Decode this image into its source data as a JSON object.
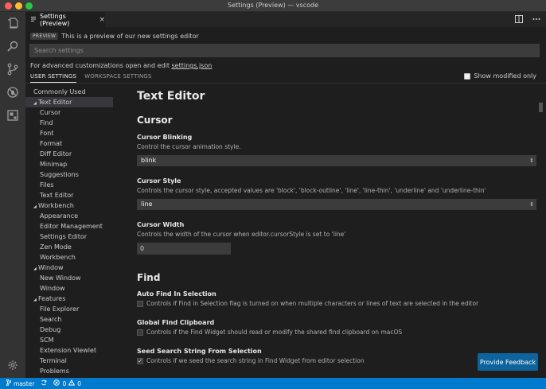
{
  "window": {
    "title": "Settings (Preview) — vscode"
  },
  "tab": {
    "label": "Settings (Preview)",
    "close": "×"
  },
  "preview": {
    "badge": "PREVIEW",
    "text": "This is a preview of our new settings editor"
  },
  "search": {
    "placeholder": "Search settings"
  },
  "advanced": {
    "prefix": "For advanced customizations open and edit ",
    "link": "settings.json"
  },
  "scopes": {
    "user": "USER SETTINGS",
    "workspace": "WORKSPACE SETTINGS",
    "show_modified": "Show modified only"
  },
  "toc": [
    {
      "label": "Commonly Used",
      "level": 0,
      "tri": ""
    },
    {
      "label": "Text Editor",
      "level": 1,
      "tri": "◢",
      "selected": true
    },
    {
      "label": "Cursor",
      "level": 2
    },
    {
      "label": "Find",
      "level": 2
    },
    {
      "label": "Font",
      "level": 2
    },
    {
      "label": "Format",
      "level": 2
    },
    {
      "label": "Diff Editor",
      "level": 2
    },
    {
      "label": "Minimap",
      "level": 2
    },
    {
      "label": "Suggestions",
      "level": 2
    },
    {
      "label": "Files",
      "level": 2
    },
    {
      "label": "Text Editor",
      "level": 2
    },
    {
      "label": "Workbench",
      "level": 1,
      "tri": "◢"
    },
    {
      "label": "Appearance",
      "level": 2
    },
    {
      "label": "Editor Management",
      "level": 2
    },
    {
      "label": "Settings Editor",
      "level": 2
    },
    {
      "label": "Zen Mode",
      "level": 2
    },
    {
      "label": "Workbench",
      "level": 2
    },
    {
      "label": "Window",
      "level": 1,
      "tri": "◢"
    },
    {
      "label": "New Window",
      "level": 2
    },
    {
      "label": "Window",
      "level": 2
    },
    {
      "label": "Features",
      "level": 1,
      "tri": "◢"
    },
    {
      "label": "File Explorer",
      "level": 2
    },
    {
      "label": "Search",
      "level": 2
    },
    {
      "label": "Debug",
      "level": 2
    },
    {
      "label": "SCM",
      "level": 2
    },
    {
      "label": "Extension Viewlet",
      "level": 2
    },
    {
      "label": "Terminal",
      "level": 2
    },
    {
      "label": "Problems",
      "level": 2
    }
  ],
  "content": {
    "group_title": "Text Editor",
    "cursor_section": "Cursor",
    "cursor_blinking": {
      "title": "Cursor Blinking",
      "desc": "Control the cursor animation style.",
      "value": "blink"
    },
    "cursor_style": {
      "title": "Cursor Style",
      "desc": "Controls the cursor style, accepted values are 'block', 'block-outline', 'line', 'line-thin', 'underline' and 'underline-thin'",
      "value": "line"
    },
    "cursor_width": {
      "title": "Cursor Width",
      "desc": "Controls the width of the cursor when editor.cursorStyle is set to 'line'",
      "value": "0"
    },
    "find_section": "Find",
    "auto_find": {
      "title": "Auto Find In Selection",
      "desc": "Controls if Find in Selection flag is turned on when multiple characters or lines of text are selected in the editor",
      "checked": false
    },
    "global_clipboard": {
      "title": "Global Find Clipboard",
      "desc": "Controls if the Find Widget should read or modify the shared find clipboard on macOS",
      "checked": false
    },
    "seed_search": {
      "title": "Seed Search String From Selection",
      "desc": "Controls if we seed the search string in Find Widget from editor selection",
      "checked": true,
      "check_mark": "✓"
    }
  },
  "feedback": {
    "label": "Provide Feedback"
  },
  "status": {
    "branch": "master",
    "errors": "0",
    "warnings": "0"
  },
  "colors": {
    "accent": "#007acc",
    "button": "#0e639c"
  }
}
